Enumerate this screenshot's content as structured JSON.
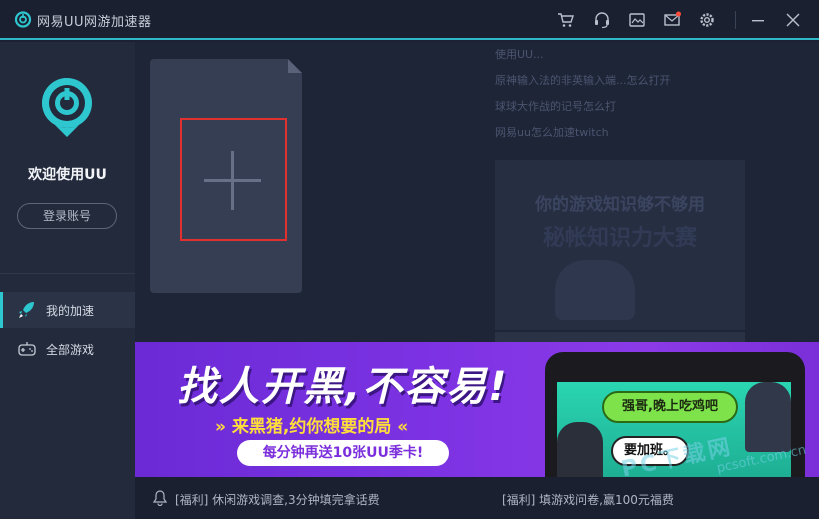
{
  "titlebar": {
    "title": "网易UU网游加速器",
    "icons": [
      "cart-icon",
      "headset-icon",
      "skin-icon",
      "mail-icon",
      "settings-icon",
      "minimize-icon",
      "close-icon"
    ],
    "accent": "#2fb8c8",
    "notification_dot": "#ff4b3a"
  },
  "sidebar": {
    "welcome": "欢迎使用UU",
    "login_label": "登录账号",
    "nav": [
      {
        "label": "我的加速",
        "icon": "rocket-icon",
        "active": true
      },
      {
        "label": "全部游戏",
        "icon": "gamepad-icon",
        "active": false
      }
    ]
  },
  "main": {
    "add_card_icon": "plus-icon",
    "news": [
      "使用UU...",
      "原神输入法的非英输入端...怎么打开",
      "球球大作战的记号怎么打",
      "网易uu怎么加速twitch"
    ],
    "promo_line1": "你的游戏知识够不够用",
    "promo_line2": "秘帐知识力大赛"
  },
  "banner": {
    "title": "找人开黑,不容易!",
    "subtitle": "来黑猪,约你想要的局",
    "pill": "每分钟再送10张UU季卡!",
    "bubble1": "强哥,晚上吃鸡吧",
    "bubble2": "要加班。"
  },
  "notice": {
    "item1": "[福利] 休闲游戏调查,3分钟填完拿话费",
    "item2": "[福利] 填游戏问卷,赢100元福费"
  },
  "watermark": {
    "big": "PC下载网",
    "small": "pcsoft.com.cn"
  }
}
